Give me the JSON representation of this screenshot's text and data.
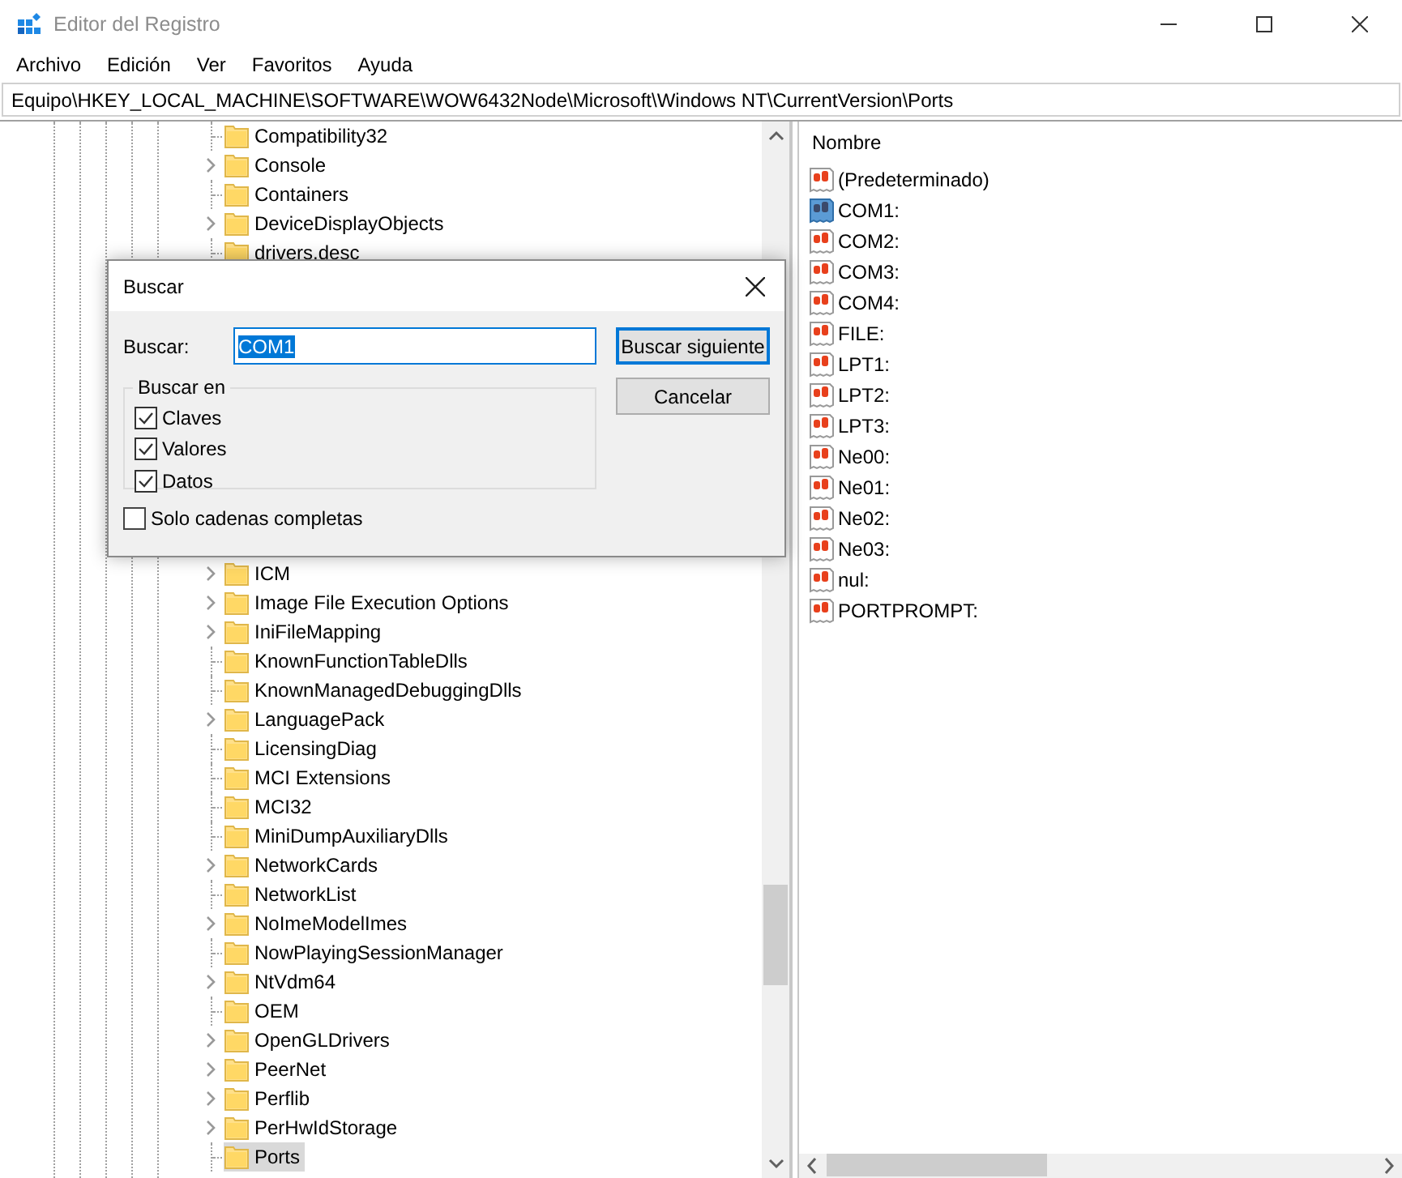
{
  "window": {
    "title": "Editor del Registro"
  },
  "menu": [
    "Archivo",
    "Edición",
    "Ver",
    "Favoritos",
    "Ayuda"
  ],
  "address": "Equipo\\HKEY_LOCAL_MACHINE\\SOFTWARE\\WOW6432Node\\Microsoft\\Windows NT\\CurrentVersion\\Ports",
  "tree": {
    "items_above_dialog": [
      {
        "label": "Compatibility32",
        "has_children": false,
        "selected": false
      },
      {
        "label": "Console",
        "has_children": true,
        "selected": false
      },
      {
        "label": "Containers",
        "has_children": false,
        "selected": false
      },
      {
        "label": "DeviceDisplayObjects",
        "has_children": true,
        "selected": false
      },
      {
        "label": "drivers.desc",
        "has_children": false,
        "selected": false
      }
    ],
    "items_below_dialog": [
      {
        "label": "ICM",
        "has_children": true,
        "selected": false
      },
      {
        "label": "Image File Execution Options",
        "has_children": true,
        "selected": false
      },
      {
        "label": "IniFileMapping",
        "has_children": true,
        "selected": false
      },
      {
        "label": "KnownFunctionTableDlls",
        "has_children": false,
        "selected": false
      },
      {
        "label": "KnownManagedDebuggingDlls",
        "has_children": false,
        "selected": false
      },
      {
        "label": "LanguagePack",
        "has_children": true,
        "selected": false
      },
      {
        "label": "LicensingDiag",
        "has_children": false,
        "selected": false
      },
      {
        "label": "MCI Extensions",
        "has_children": false,
        "selected": false
      },
      {
        "label": "MCI32",
        "has_children": false,
        "selected": false
      },
      {
        "label": "MiniDumpAuxiliaryDlls",
        "has_children": false,
        "selected": false
      },
      {
        "label": "NetworkCards",
        "has_children": true,
        "selected": false
      },
      {
        "label": "NetworkList",
        "has_children": false,
        "selected": false
      },
      {
        "label": "NoImeModelImes",
        "has_children": true,
        "selected": false
      },
      {
        "label": "NowPlayingSessionManager",
        "has_children": false,
        "selected": false
      },
      {
        "label": "NtVdm64",
        "has_children": true,
        "selected": false
      },
      {
        "label": "OEM",
        "has_children": false,
        "selected": false
      },
      {
        "label": "OpenGLDrivers",
        "has_children": true,
        "selected": false
      },
      {
        "label": "PeerNet",
        "has_children": true,
        "selected": false
      },
      {
        "label": "Perflib",
        "has_children": true,
        "selected": false
      },
      {
        "label": "PerHwIdStorage",
        "has_children": true,
        "selected": false
      },
      {
        "label": "Ports",
        "has_children": false,
        "selected": true
      }
    ]
  },
  "values": {
    "column": "Nombre",
    "rows": [
      {
        "name": "(Predeterminado)",
        "selected": false
      },
      {
        "name": "COM1:",
        "selected": true
      },
      {
        "name": "COM2:",
        "selected": false
      },
      {
        "name": "COM3:",
        "selected": false
      },
      {
        "name": "COM4:",
        "selected": false
      },
      {
        "name": "FILE:",
        "selected": false
      },
      {
        "name": "LPT1:",
        "selected": false
      },
      {
        "name": "LPT2:",
        "selected": false
      },
      {
        "name": "LPT3:",
        "selected": false
      },
      {
        "name": "Ne00:",
        "selected": false
      },
      {
        "name": "Ne01:",
        "selected": false
      },
      {
        "name": "Ne02:",
        "selected": false
      },
      {
        "name": "Ne03:",
        "selected": false
      },
      {
        "name": "nul:",
        "selected": false
      },
      {
        "name": "PORTPROMPT:",
        "selected": false
      }
    ]
  },
  "dialog": {
    "title": "Buscar",
    "field_label": "Buscar:",
    "value": "COM1",
    "group": "Buscar en",
    "options": [
      {
        "label": "Claves",
        "checked": true
      },
      {
        "label": "Valores",
        "checked": true
      },
      {
        "label": "Datos",
        "checked": true
      }
    ],
    "whole_string": {
      "label": "Solo cadenas completas",
      "checked": false
    },
    "buttons": [
      {
        "label": "Buscar siguiente",
        "default": true
      },
      {
        "label": "Cancelar",
        "default": false
      }
    ]
  }
}
